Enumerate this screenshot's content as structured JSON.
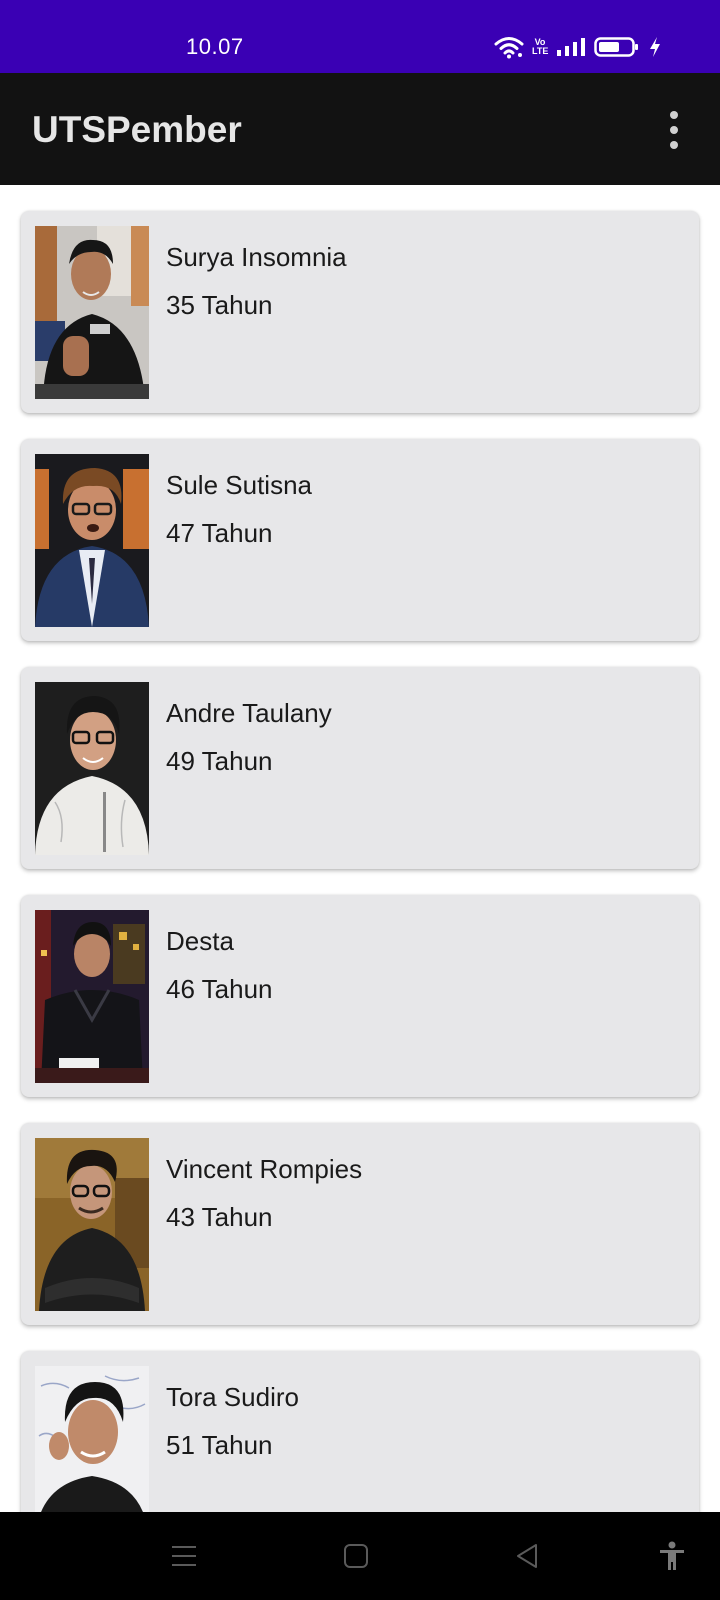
{
  "status_bar": {
    "time": "10.07",
    "volte_top": "Vo",
    "volte_bottom": "LTE",
    "background": "#3a00b4"
  },
  "app_bar": {
    "title": "UTSPember",
    "overflow_icon": "more-vert-icon"
  },
  "people": [
    {
      "name": "Surya Insomnia",
      "age": "35 Tahun"
    },
    {
      "name": "Sule Sutisna",
      "age": "47 Tahun"
    },
    {
      "name": "Andre Taulany",
      "age": "49 Tahun"
    },
    {
      "name": "Desta",
      "age": "46 Tahun"
    },
    {
      "name": "Vincent Rompies",
      "age": "43 Tahun"
    },
    {
      "name": "Tora Sudiro",
      "age": "51 Tahun"
    }
  ],
  "nav_bar": {
    "icons": [
      "menu-icon",
      "home-square-icon",
      "back-triangle-icon",
      "accessibility-icon"
    ]
  },
  "colors": {
    "card_background": "#e7e7e9",
    "app_bar": "#121212"
  }
}
